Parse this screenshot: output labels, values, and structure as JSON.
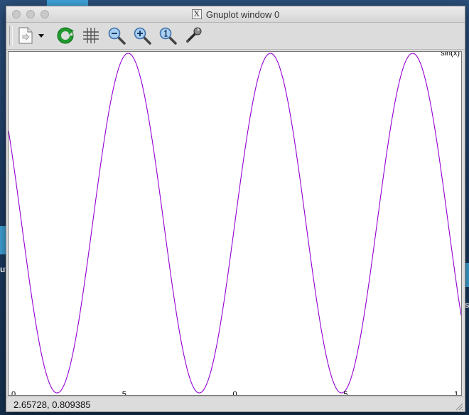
{
  "window": {
    "title": "Gnuplot window 0",
    "title_icon_glyph": "X"
  },
  "desktop": {
    "left_edge_text": "ut",
    "right_edge_text": "s"
  },
  "toolbar": {
    "buttons": [
      {
        "name": "export-button",
        "icon": "export-page-icon"
      },
      {
        "name": "export-menu-arrow",
        "icon": "triangle-down-icon"
      },
      {
        "name": "replot-button",
        "icon": "refresh-icon"
      },
      {
        "name": "grid-button",
        "icon": "grid-icon"
      },
      {
        "name": "zoom-previous-button",
        "icon": "zoom-out-icon"
      },
      {
        "name": "zoom-next-button",
        "icon": "zoom-in-icon"
      },
      {
        "name": "autoscale-button",
        "icon": "zoom-reset-icon"
      },
      {
        "name": "settings-button",
        "icon": "wrench-icon"
      }
    ]
  },
  "statusbar": {
    "coordinates": "2.65728,  0.809385"
  },
  "colors": {
    "curve": "#9400d3",
    "plot_bg": "#ffffff"
  },
  "chart_data": {
    "type": "line",
    "title": "",
    "key": "sin(x)",
    "xlabel": "",
    "ylabel": "",
    "xlim": [
      -10,
      10
    ],
    "ylim": [
      -1,
      1
    ],
    "x_tick_labels": [
      "0",
      "5",
      "0",
      "5",
      "1"
    ],
    "grid": false,
    "legend_placement": "top-right",
    "series": [
      {
        "name": "sin(x)",
        "function": "sin(x)",
        "color": "#9400d3",
        "samples": 100
      }
    ]
  }
}
